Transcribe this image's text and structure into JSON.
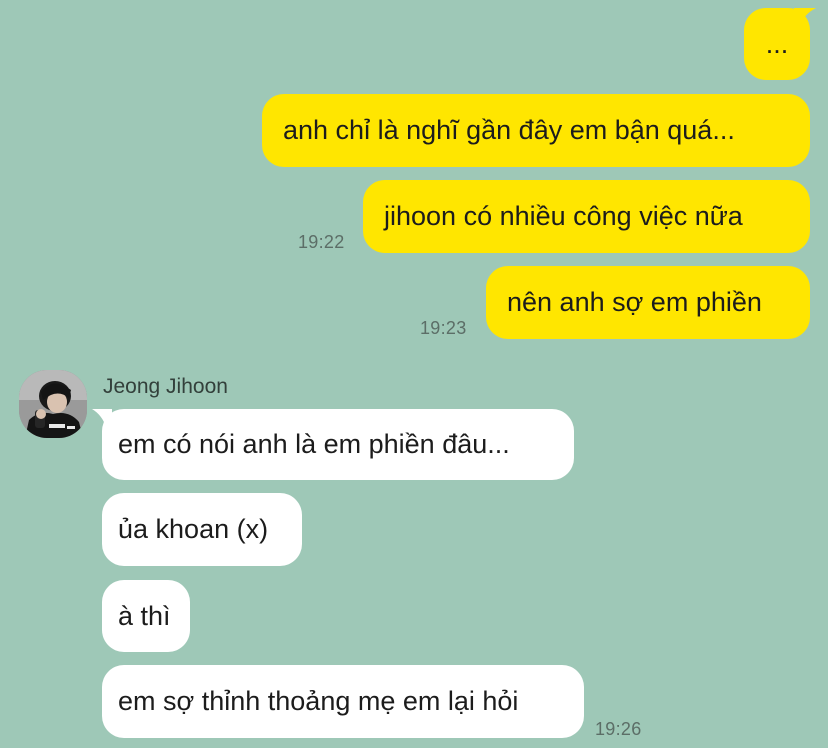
{
  "colors": {
    "background": "#9ec8b7",
    "outgoing_bubble": "#ffe600",
    "incoming_bubble": "#ffffff",
    "timestamp": "#5c6e67"
  },
  "outgoing": [
    {
      "text": "..."
    },
    {
      "text": "anh chỉ là nghĩ gần đây em bận quá..."
    },
    {
      "text": "jihoon có nhiều công việc nữa",
      "time": "19:22"
    },
    {
      "text": "nên anh sợ em phiền",
      "time": "19:23"
    }
  ],
  "incoming": {
    "sender": "Jeong Jihoon",
    "avatar_icon": "profile-photo-icon",
    "messages": [
      {
        "text": "em có nói anh là em phiền đâu..."
      },
      {
        "text": "ủa khoan (x)"
      },
      {
        "text": "à thì"
      },
      {
        "text": "em sợ thỉnh thoảng mẹ em lại hỏi",
        "time": "19:26"
      }
    ]
  }
}
